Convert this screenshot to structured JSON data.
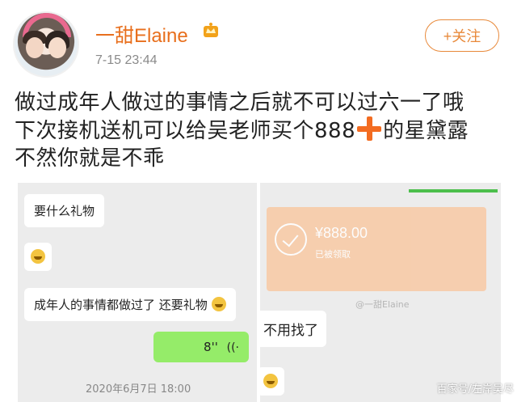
{
  "post": {
    "username": "一甜Elaine",
    "timestamp": "7-15 23:44",
    "follow_label": "+关注",
    "text_lines": [
      "做过成年人做过的事情之后就不可以过六一了哦",
      "下次接机送机可以给吴老师买个888",
      "的星黛露",
      "不然你就是不乖"
    ]
  },
  "left_image": {
    "bubbles": [
      "要什么礼物",
      "成年人的事情都做过了 还要礼物"
    ],
    "voice_label": "8''",
    "date": "2020年6月7日 18:00"
  },
  "right_image": {
    "pay_amount": "¥888.00",
    "pay_sub": "已被领取",
    "watermark": "@一甜Elaine",
    "bubble_text": "不用找了"
  },
  "source_label": "百家号/左岸吴尽",
  "colors": {
    "username": "#e86f1d",
    "follow": "#e8893a",
    "plus": "#f36c21",
    "chat_green": "#95ec69"
  }
}
